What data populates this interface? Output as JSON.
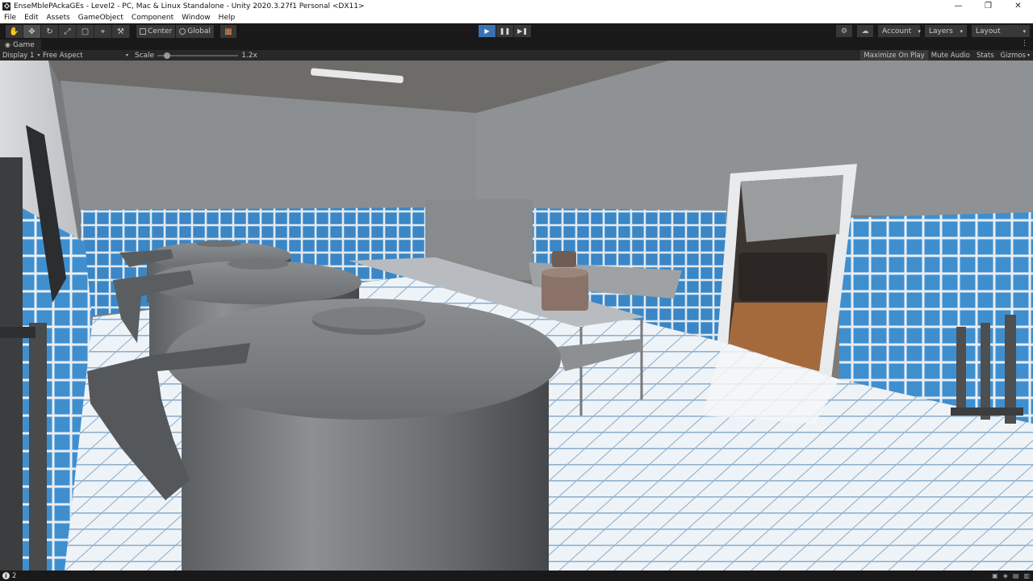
{
  "window": {
    "title": "EnseMblePAckaGEs - Level2 - PC, Mac & Linux Standalone - Unity 2020.3.27f1 Personal <DX11>",
    "minimize": "—",
    "maximize": "❐",
    "close": "✕"
  },
  "menu": [
    "File",
    "Edit",
    "Assets",
    "GameObject",
    "Component",
    "Window",
    "Help"
  ],
  "toolbar": {
    "tools": [
      "hand-tool",
      "move-tool",
      "rotate-tool",
      "scale-tool",
      "rect-tool",
      "transform-tool",
      "custom-tool"
    ],
    "tool_glyphs": [
      "✋",
      "✥",
      "↻",
      "⤢",
      "▢",
      "⌖",
      "⚒"
    ],
    "pivot_label": "Center",
    "space_label": "Global",
    "grid_glyph": "▦",
    "play": "▶",
    "pause": "❚❚",
    "step": "▶❚",
    "cloud_glyph": "☁",
    "collab_glyph": "⚙",
    "account_label": "Account",
    "layers_label": "Layers",
    "layout_label": "Layout",
    "caret": "▾"
  },
  "game_tab": {
    "label": "Game",
    "icon_glyph": "◉",
    "kebab": "⋮"
  },
  "game_toolbar": {
    "display": "Display 1",
    "aspect": "Free Aspect",
    "scale_label": "Scale",
    "scale_value": "1.2x",
    "scale_fraction": 0.12,
    "maximize_on_play": "Maximize On Play",
    "mute_audio": "Mute Audio",
    "stats": "Stats",
    "gizmos": "Gizmos"
  },
  "status": {
    "count": "2",
    "info_glyph": "i",
    "right_icons": [
      "▣",
      "◈",
      "▤",
      "▥"
    ]
  },
  "colors": {
    "tile_blue": "#3f8fcf",
    "wall_gray": "#8e9193",
    "floor": "#e3ebf2",
    "play_active": "#3a72b0"
  }
}
